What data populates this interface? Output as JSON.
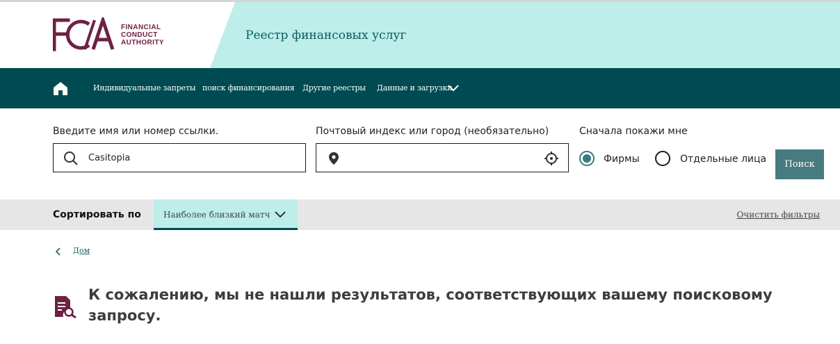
{
  "logo": {
    "mark": "FCA",
    "lines": [
      "FINANCIAL",
      "CONDUCT",
      "AUTHORITY"
    ]
  },
  "header": {
    "title": "Реестр финансовых услуг"
  },
  "nav": {
    "items": [
      {
        "label": "Индивидуальные запреты"
      },
      {
        "label": "поиск финансирования"
      },
      {
        "label": "Другие реестры"
      },
      {
        "label": "Данные и загрузки"
      }
    ]
  },
  "search": {
    "name_label": "Введите имя или номер ссылки.",
    "name_value": "Casitopia",
    "location_label": "Почтовый индекс или город (необязательно)",
    "location_value": "",
    "show_first_label": "Сначала покажи мне",
    "options": [
      {
        "label": "Фирмы",
        "checked": true
      },
      {
        "label": "Отдельные лица",
        "checked": false
      }
    ],
    "button_label": "Поиск"
  },
  "sort": {
    "label": "Сортировать по",
    "selected": "Наиболее близкий матч",
    "clear_filters": "Очистить фильтры"
  },
  "breadcrumb": {
    "home": "Дом"
  },
  "results": {
    "message": "К сожалению, мы не нашли результатов, соответствующих вашему поисковому запросу."
  },
  "colors": {
    "brand": "#6e2142",
    "nav_bg": "#004b51",
    "header_teal": "#bdeee9",
    "button": "#487b80"
  }
}
